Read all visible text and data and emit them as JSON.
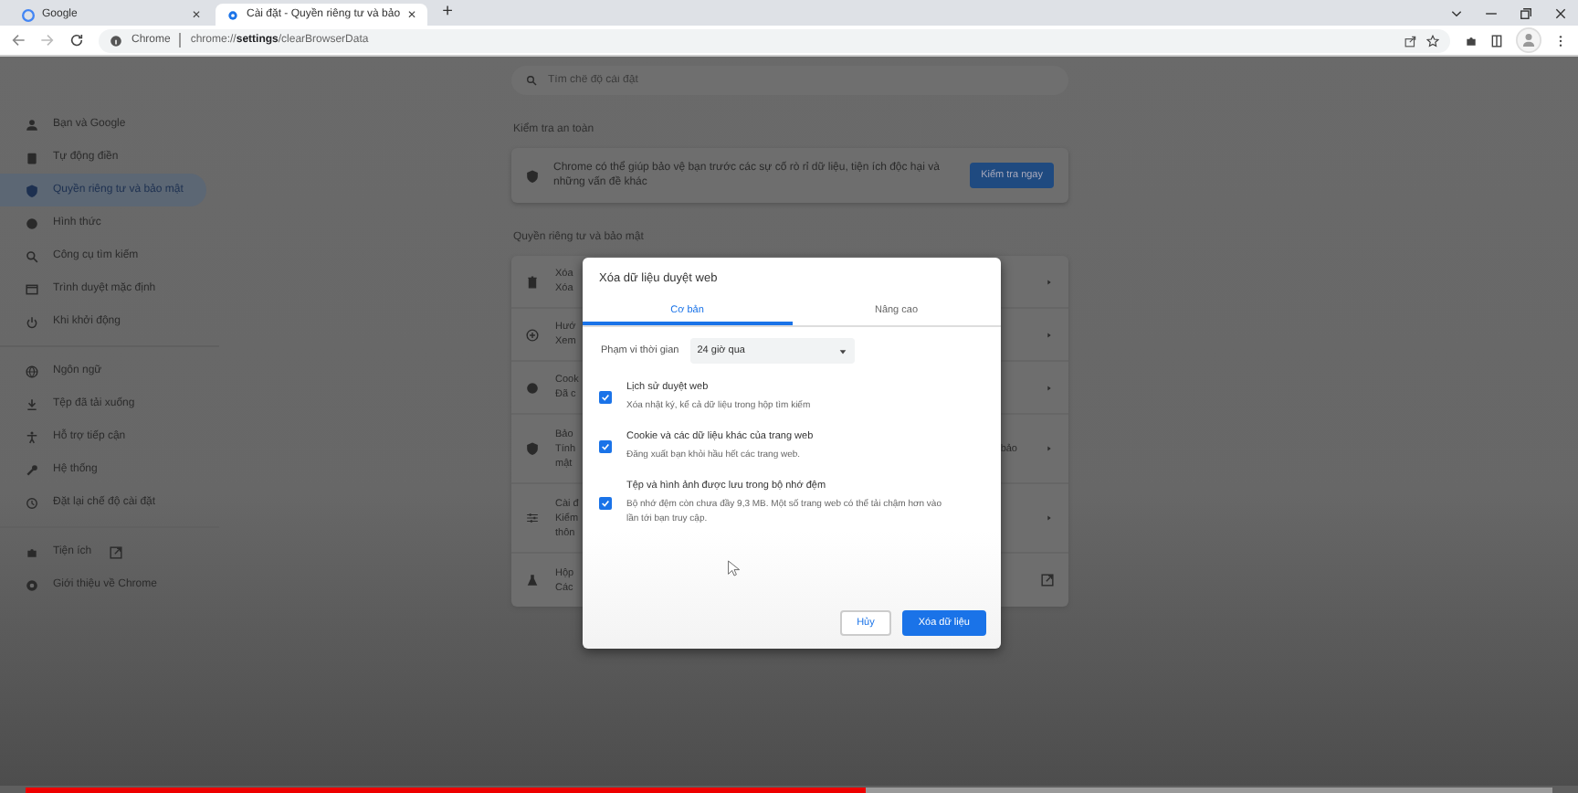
{
  "browser": {
    "tabs": [
      {
        "title": "Google",
        "selected": false,
        "close": "✕"
      },
      {
        "title": "Cài đặt - Quyền riêng tư và bảo",
        "selected": true,
        "close": "✕"
      }
    ],
    "new_tab": "+",
    "address": {
      "label": "Chrome",
      "url": "chrome://**settings**/clearBrowserData"
    }
  },
  "sidebar": {
    "groups": [
      [
        {
          "label": "Bạn và Google",
          "kind": "page",
          "selected": false
        },
        {
          "label": "Tự động điền",
          "kind": "page",
          "selected": false
        },
        {
          "label": "Quyền riêng tư và bảo mật",
          "kind": "page",
          "selected": true
        },
        {
          "label": "Hình thức",
          "kind": "page",
          "selected": false
        },
        {
          "label": "Công cụ tìm kiếm",
          "kind": "page",
          "selected": false
        },
        {
          "label": "Trình duyệt mặc định",
          "kind": "page",
          "selected": false
        },
        {
          "label": "Khi khởi động",
          "kind": "page",
          "selected": false
        }
      ],
      [
        {
          "label": "Ngôn ngữ",
          "kind": "page",
          "selected": false
        },
        {
          "label": "Tệp đã tải xuống",
          "kind": "page",
          "selected": false
        },
        {
          "label": "Hỗ trợ tiếp cận",
          "kind": "page",
          "selected": false
        },
        {
          "label": "Hệ thống",
          "kind": "page",
          "selected": false
        },
        {
          "label": "Đặt lại chế độ cài đặt",
          "kind": "page",
          "selected": false
        }
      ],
      [
        {
          "label": "Tiện ích",
          "kind": "link",
          "selected": false
        },
        {
          "label": "Giới thiệu về Chrome",
          "kind": "page",
          "selected": false
        }
      ]
    ]
  },
  "main": {
    "search": {
      "placeholder": "Tìm chế độ cài đặt"
    },
    "safety": {
      "heading": "Kiểm tra an toàn",
      "text": "Chrome có thể giúp bảo vệ bạn trước các sự cố rò rỉ dữ liệu, tiện ích độc hại và những vấn đề khác",
      "button": "Kiểm tra ngay"
    },
    "privacy": {
      "heading": "Quyền riêng tư và bảo mật",
      "rows": [
        {
          "lines": [
            "Xóa",
            "Xóa"
          ],
          "kind": "submenu"
        },
        {
          "lines": [
            "Hướ",
            "Xem"
          ],
          "kind": "submenu"
        },
        {
          "lines": [
            "Cook",
            "Đã c"
          ],
          "kind": "submenu"
        },
        {
          "lines": [
            "Bảo",
            "Tính",
            "mật"
          ],
          "tail": "bảo",
          "kind": "submenu"
        },
        {
          "lines": [
            "Cài đ",
            "Kiểm",
            "thôn"
          ],
          "kind": "submenu"
        },
        {
          "lines": [
            "Hộp",
            "Các"
          ],
          "kind": "external"
        }
      ]
    }
  },
  "dialog": {
    "title": "Xóa dữ liệu duyệt web",
    "tabs": [
      {
        "label": "Cơ bản",
        "selected": true
      },
      {
        "label": "Nâng cao",
        "selected": false
      }
    ],
    "time_range": {
      "label": "Phạm vi thời gian",
      "value": "24 giờ qua"
    },
    "options": [
      {
        "title": "Lịch sử duyệt web",
        "description": "Xóa nhật ký, kể cả dữ liệu trong hộp tìm kiếm",
        "checked": true
      },
      {
        "title": "Cookie và các dữ liệu khác của trang web",
        "description": "Đăng xuất bạn khỏi hầu hết các trang web.",
        "checked": true
      },
      {
        "title": "Tệp và hình ảnh được lưu trong bộ nhớ đệm",
        "description": "Bộ nhớ đệm còn chưa đầy 9,3 MB. Một số trang web có thể tải chậm hơn vào lần tới bạn truy cập.",
        "checked": true
      }
    ],
    "buttons": [
      {
        "label": "Hủy",
        "kind": "secondary"
      },
      {
        "label": "Xóa dữ liệu",
        "kind": "primary"
      }
    ]
  },
  "video_progress": {
    "level": 0.55
  }
}
